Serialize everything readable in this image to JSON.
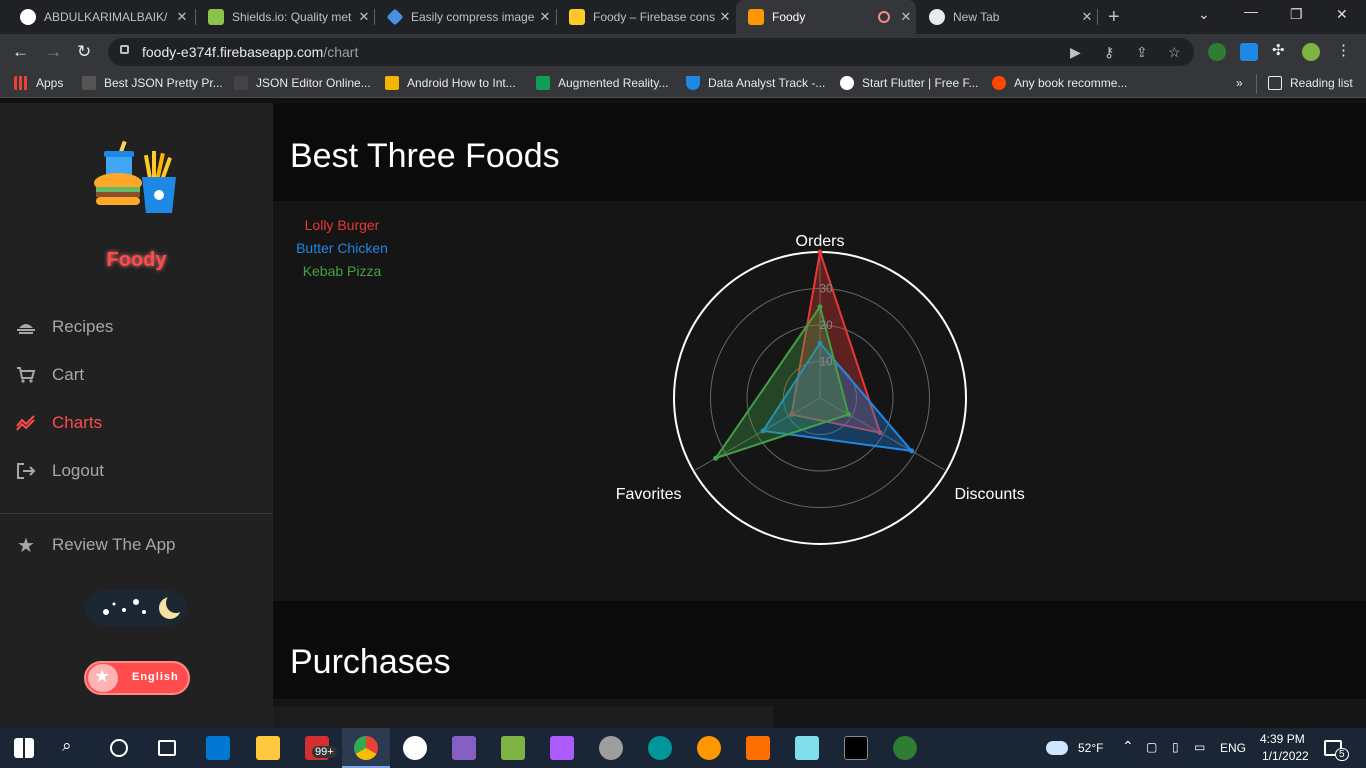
{
  "browser": {
    "tabs": [
      {
        "title": "ABDULKARIMALBAIK/",
        "icon": "github-icon",
        "color": "#ffffff"
      },
      {
        "title": "Shields.io: Quality met",
        "icon": "shields-icon",
        "color": "#8bc34a"
      },
      {
        "title": "Easily compress image",
        "icon": "compress-icon",
        "color": "#4a90e2"
      },
      {
        "title": "Foody – Firebase cons",
        "icon": "firebase-icon",
        "color": "#ffca28"
      },
      {
        "title": "Foody",
        "icon": "foody-icon",
        "color": "#ff9800",
        "active": true
      },
      {
        "title": "New Tab",
        "icon": "chrome-icon",
        "color": "#e8eaed"
      }
    ],
    "url_host": "foody-e374f.firebaseapp.com",
    "url_path": "/chart",
    "bookmarks": [
      {
        "label": "Apps",
        "color": "#e94235"
      },
      {
        "label": "Best JSON Pretty Pr...",
        "color": "#555555"
      },
      {
        "label": "JSON Editor Online...",
        "color": "#444444"
      },
      {
        "label": "Android How to Int...",
        "color": "#f4b400"
      },
      {
        "label": "Augmented Reality...",
        "color": "#0f9d58"
      },
      {
        "label": "Data Analyst Track -...",
        "color": "#1e88e5"
      },
      {
        "label": "Start Flutter | Free F...",
        "color": "#ffffff"
      },
      {
        "label": "Any book recomme...",
        "color": "#ff4500"
      }
    ],
    "reading_list": "Reading list",
    "overflow": "»"
  },
  "sidebar": {
    "brand": "Foody",
    "nav": [
      {
        "label": "Recipes",
        "icon": "recipes-icon",
        "active": false
      },
      {
        "label": "Cart",
        "icon": "cart-icon",
        "active": false
      },
      {
        "label": "Charts",
        "icon": "chart-icon",
        "active": true
      },
      {
        "label": "Logout",
        "icon": "logout-icon",
        "active": false
      }
    ],
    "review": "Review The App",
    "language_toggle": "English"
  },
  "main": {
    "section1_title": "Best Three Foods",
    "section2_title": "Purchases"
  },
  "chart_data": {
    "type": "radar",
    "axes": [
      "Orders",
      "Discounts",
      "Favorites"
    ],
    "rlim": [
      0,
      40
    ],
    "ticks": [
      10,
      20,
      30
    ],
    "legend_position": "top-left",
    "series": [
      {
        "name": "Lolly Burger",
        "color": "#e53935",
        "values": [
          40,
          19,
          9
        ]
      },
      {
        "name": "Butter Chicken",
        "color": "#1e88e5",
        "values": [
          15,
          29,
          18
        ]
      },
      {
        "name": "Kebab Pizza",
        "color": "#43a047",
        "values": [
          25,
          9,
          33
        ]
      }
    ]
  },
  "taskbar": {
    "weather": "52°F",
    "language": "ENG",
    "time": "4:39 PM",
    "date": "1/1/2022",
    "notifications": "5",
    "badge": "99+"
  }
}
